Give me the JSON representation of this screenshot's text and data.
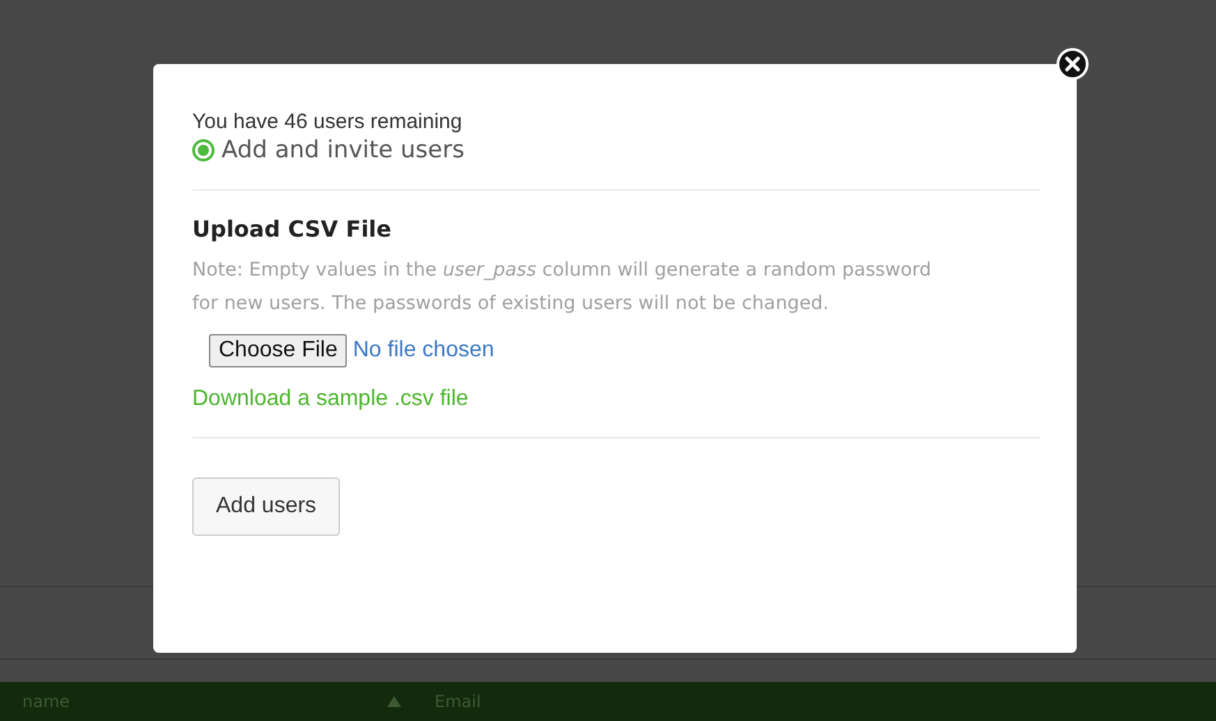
{
  "remaining_text": "You have 46 users remaining",
  "mode": {
    "label": "Add and invite users",
    "selected": true
  },
  "section_title": "Upload CSV File",
  "note": "Note: Empty values in the *user_pass* column will generate a random password for new users. The passwords of existing users will not be changed.",
  "file_input": {
    "button": "Choose File",
    "status": "No file chosen"
  },
  "sample_link": "Download a sample .csv file",
  "submit_button": "Add users",
  "background_table": {
    "columns": [
      "name",
      "Email"
    ]
  }
}
